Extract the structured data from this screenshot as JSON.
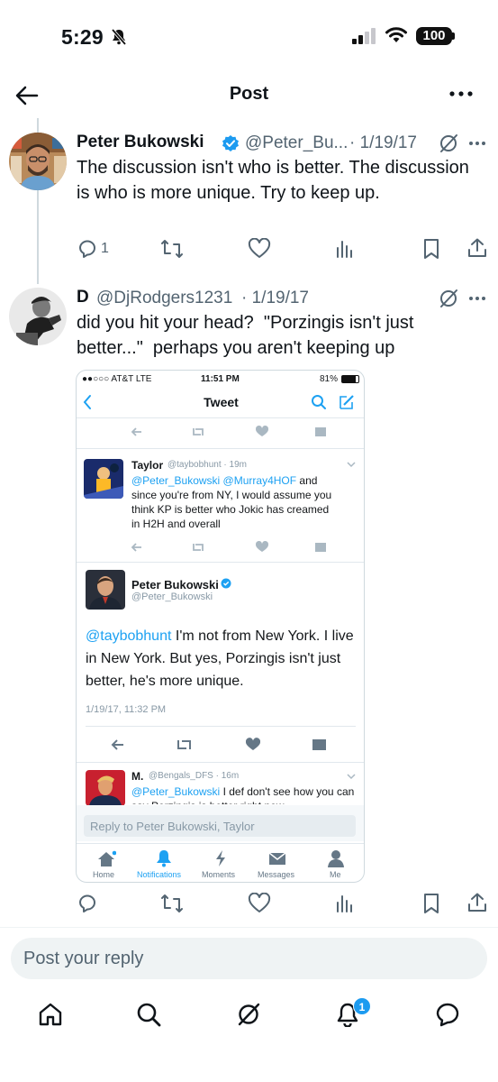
{
  "status_bar": {
    "time": "5:29",
    "battery": "100"
  },
  "header": {
    "title": "Post"
  },
  "tweet1": {
    "name": "Peter Bukowski",
    "handle": "@Peter_Bu...",
    "date": "· 1/19/17",
    "text": "The discussion isn't who is better. The discussion is who is more unique. Try to keep up.",
    "reply_count": "1"
  },
  "tweet2": {
    "name": "D",
    "handle": "@DjRodgers1231",
    "date": "· 1/19/17",
    "text": "did you hit your head?  \"Porzingis isn't just better...\"  perhaps you aren't keeping up"
  },
  "embed": {
    "status": {
      "carrier": "●●○○○ AT&T  LTE",
      "time": "11:51 PM",
      "battery": "81%"
    },
    "title": "Tweet",
    "taylor": {
      "name": "Taylor",
      "handle": "@taybobhunt · 19m",
      "mentions": "@Peter_Bukowski @Murray4HOF",
      "text_after": " and since you're from NY, I would assume you think KP is better who Jokic has creamed in H2H and overall"
    },
    "peter": {
      "name": "Peter Bukowski",
      "handle": "@Peter_Bukowski",
      "mention": "@taybobhunt",
      "text": " I'm not from New York. I live in New York. But yes, Porzingis isn't just better, he's more unique.",
      "timestamp": "1/19/17, 11:32 PM"
    },
    "m": {
      "name": "M.",
      "handle": "@Bengals_DFS · 16m",
      "mention": "@Peter_Bukowski",
      "text": " I def don't see how you can say Porzingis is better right now"
    },
    "reply_placeholder": "Reply to Peter Bukowski, Taylor",
    "tabs": [
      "Home",
      "Notifications",
      "Moments",
      "Messages",
      "Me"
    ]
  },
  "reply": {
    "placeholder": "Post your reply"
  },
  "bottom_nav": {
    "notification_badge": "1"
  },
  "colors": {
    "accent": "#1d9bf0",
    "verified": "#1d9bf0",
    "text_secondary": "#536471",
    "twitter_blue_old": "#1da1f2"
  }
}
